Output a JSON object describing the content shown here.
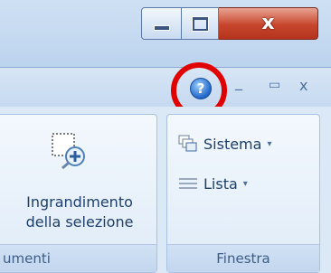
{
  "window": {
    "minimize_label": "",
    "maximize_label": "",
    "close_label": "x"
  },
  "ribbon": {
    "help_glyph": "?",
    "minimize_glyph": "_",
    "restore_glyph": "▭",
    "close_glyph": "x"
  },
  "groups": {
    "left": {
      "button_line1": "Ingrandimento",
      "button_line2": "della selezione",
      "label": "umenti"
    },
    "right": {
      "item1": "Sistema",
      "item2": "Lista",
      "label": "Finestra",
      "caret": "▾"
    }
  },
  "colors": {
    "highlight_ring": "#e00000",
    "close_button": "#c6462c",
    "ribbon_bg": "#dbe8f6"
  }
}
